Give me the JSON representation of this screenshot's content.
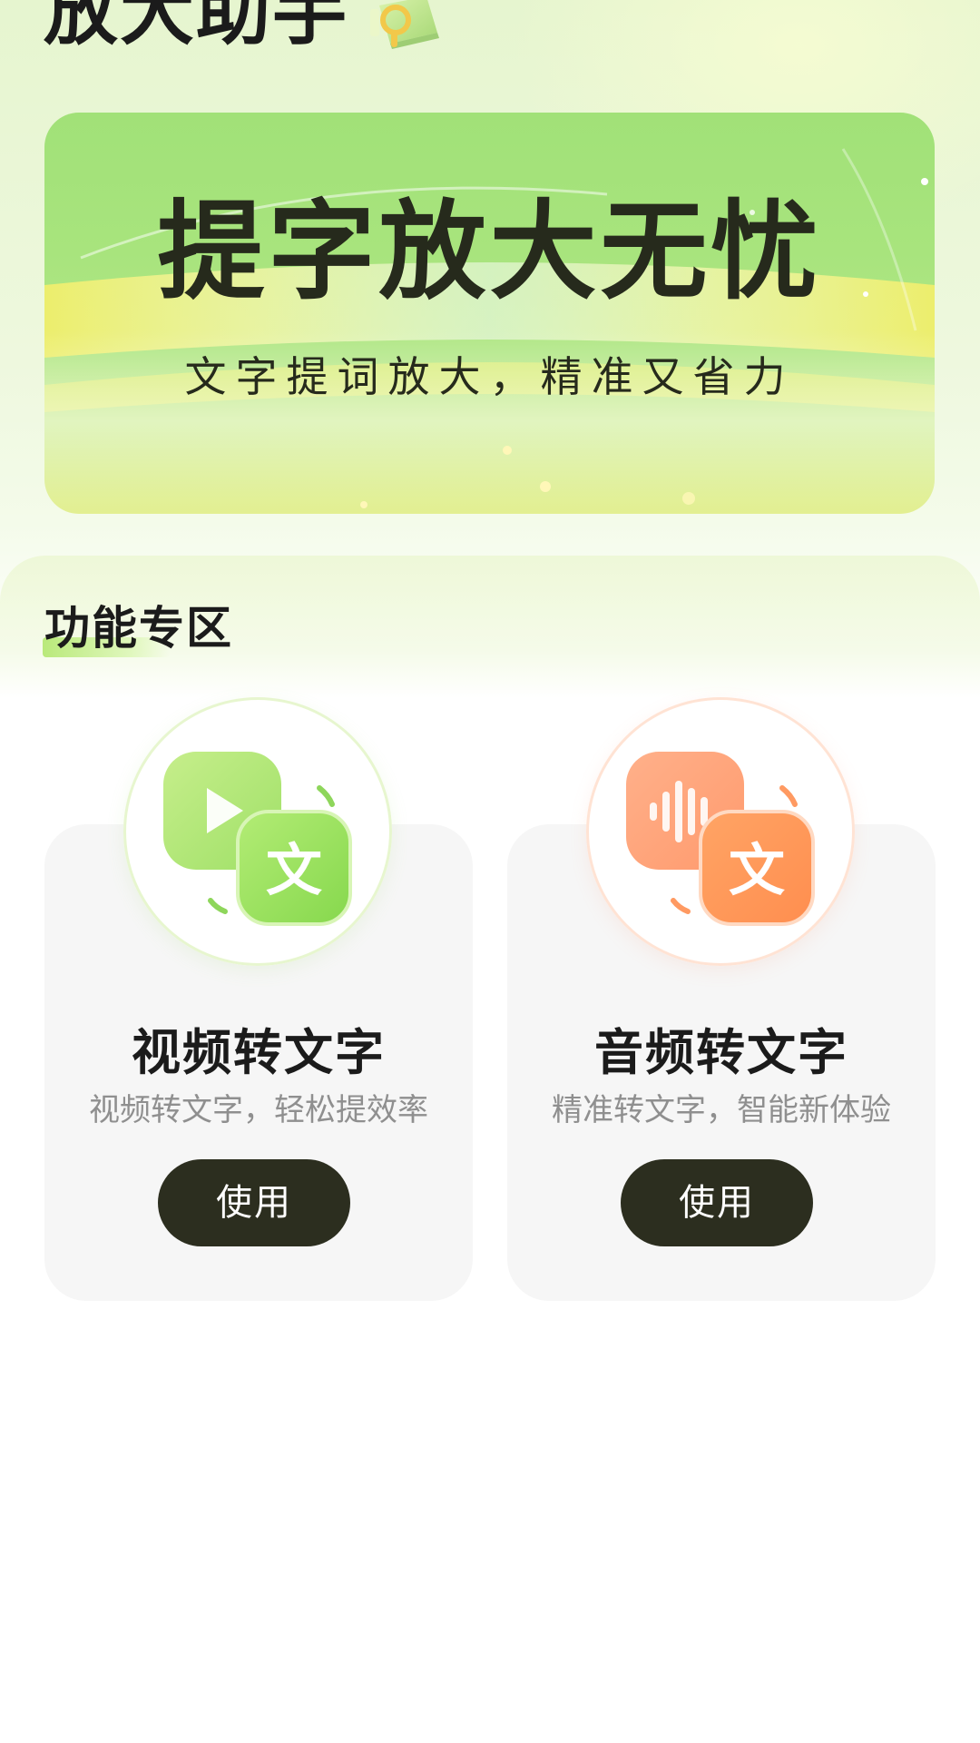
{
  "header": {
    "app_title": "放大助手"
  },
  "banner": {
    "headline": "提字放大无忧",
    "subline": "文字提词放大，精准又省力"
  },
  "features": {
    "section_title": "功能专区",
    "items": [
      {
        "title": "视频转文字",
        "desc": "视频转文字，轻松提效率",
        "button_label": "使用",
        "icon": "video-to-text-icon",
        "badge_char": "文",
        "accent": "#9ee067"
      },
      {
        "title": "音频转文字",
        "desc": "精准转文字，智能新体验",
        "button_label": "使用",
        "icon": "audio-to-text-icon",
        "badge_char": "文",
        "accent": "#ff9a62"
      }
    ]
  },
  "colors": {
    "button_bg": "#2c2e1f",
    "banner_green": "#a8e47d",
    "card_bg": "#f6f6f6"
  }
}
